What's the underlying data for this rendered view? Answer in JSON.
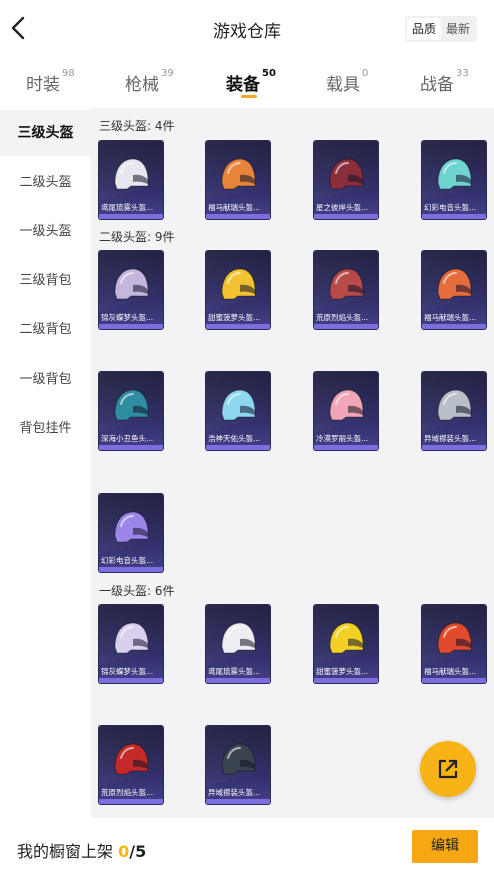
{
  "header": {
    "title": "游戏仓库",
    "sort_options": [
      "品质",
      "最新"
    ],
    "sort_selected": "品质"
  },
  "tabs": [
    {
      "label": "时装",
      "count": "98"
    },
    {
      "label": "枪械",
      "count": "39"
    },
    {
      "label": "装备",
      "count": "50",
      "active": true
    },
    {
      "label": "载具",
      "count": "0"
    },
    {
      "label": "战备",
      "count": "33"
    }
  ],
  "sidenav": [
    {
      "label": "三级头盔",
      "active": true
    },
    {
      "label": "二级头盔"
    },
    {
      "label": "一级头盔"
    },
    {
      "label": "三级背包"
    },
    {
      "label": "二级背包"
    },
    {
      "label": "一级背包"
    },
    {
      "label": "背包挂件"
    }
  ],
  "sections": [
    {
      "title": "三级头盔: 4件",
      "items": [
        {
          "name": "鸢尾琉雾头盔...",
          "icon": "white-fur-helmet-icon",
          "color": "#e8e6ee"
        },
        {
          "name": "福马献瑞头盔...",
          "icon": "orange-horse-helmet-icon",
          "color": "#e8833a"
        },
        {
          "name": "星之彼岸头盔...",
          "icon": "dark-red-helmet-icon",
          "color": "#8a2e3c"
        },
        {
          "name": "幻彩电音头盔...",
          "icon": "teal-pink-helmet-icon",
          "color": "#6fd3d0"
        }
      ]
    },
    {
      "title": "二级头盔: 9件",
      "items": [
        {
          "name": "锦灰蝶梦头盔...",
          "icon": "lavender-helmet-icon",
          "color": "#c4b6dc"
        },
        {
          "name": "甜蜜菠萝头盔...",
          "icon": "pineapple-helmet-icon",
          "color": "#f2c230"
        },
        {
          "name": "荒原烈焰头盔...",
          "icon": "red-boar-helmet-icon",
          "color": "#b84a4a"
        },
        {
          "name": "福马献瑞头盔...",
          "icon": "orange-helmet-icon",
          "color": "#e56c3c"
        },
        {
          "name": "深海小丑鱼头...",
          "icon": "clownfish-helmet-icon",
          "color": "#2e8da0"
        },
        {
          "name": "浩神天佑头盔...",
          "icon": "blue-white-helmet-icon",
          "color": "#8fd6ef"
        },
        {
          "name": "冷漠罗丽头盔...",
          "icon": "pink-pig-helmet-icon",
          "color": "#f0a6b6"
        },
        {
          "name": "异域襟装头盔...",
          "icon": "silver-helmet-icon",
          "color": "#b8bfc8"
        },
        {
          "name": "幻彩电音头盔...",
          "icon": "purple-speaker-helmet-icon",
          "color": "#9c86e8"
        }
      ]
    },
    {
      "title": "一级头盔: 6件",
      "items": [
        {
          "name": "锦灰蝶梦头盔...",
          "icon": "lavender-moto-helmet-icon",
          "color": "#d9cfee"
        },
        {
          "name": "鸢尾琉雾头盔...",
          "icon": "white-moto-helmet-icon",
          "color": "#eeeef2"
        },
        {
          "name": "甜蜜菠萝头盔...",
          "icon": "yellow-moto-helmet-icon",
          "color": "#f2d024"
        },
        {
          "name": "福马献瑞头盔...",
          "icon": "red-orange-moto-helmet-icon",
          "color": "#e24a2c"
        },
        {
          "name": "荒原烈焰头盔...",
          "icon": "crimson-moto-helmet-icon",
          "color": "#c42a2a"
        },
        {
          "name": "异域襟装头盔...",
          "icon": "dark-moto-helmet-icon",
          "color": "#3a4450"
        }
      ]
    }
  ],
  "bottom": {
    "label": "我的橱窗上架",
    "current": "0",
    "sep_max": "/5",
    "edit_label": "编辑"
  },
  "fab": {
    "icon": "share-external-icon"
  },
  "back": {
    "icon": "chevron-left-icon"
  },
  "colors": {
    "accent": "#f5a623",
    "card_bg": "#2e2c62",
    "card_strip": "#7b6fe0"
  }
}
